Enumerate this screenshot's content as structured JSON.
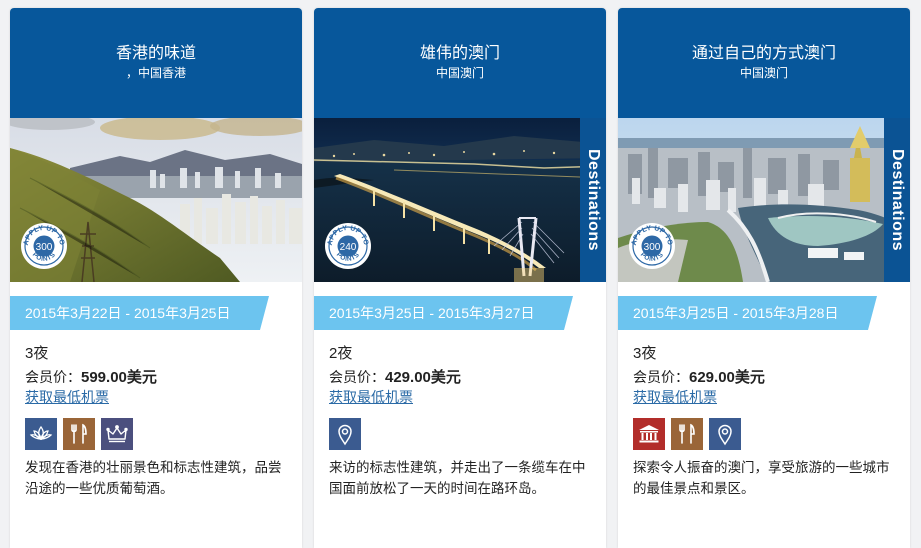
{
  "cards": [
    {
      "title": "香港的味道",
      "location": "，中国香港",
      "destinations_tag": "",
      "points_badge": {
        "top_text": "APPLY UP TO",
        "value": "300",
        "bottom_text": "POINTS"
      },
      "date_range": "2015年3月22日 - 2015年3月25日",
      "nights": "3夜",
      "price_label": "会员价：",
      "price_value": "599.00美元",
      "fare_link": "获取最低机票",
      "icons": [
        "lotus-spa-icon",
        "dining-icon",
        "crown-icon"
      ],
      "description": "发现在香港的壮丽景色和标志性建筑，品尝沿途的一些优质葡萄酒。"
    },
    {
      "title": "雄伟的澳门",
      "location": "中国澳门",
      "destinations_tag": "Destinations",
      "points_badge": {
        "top_text": "APPLY UP TO",
        "value": "240",
        "bottom_text": "POINTS"
      },
      "date_range": "2015年3月25日 - 2015年3月27日",
      "nights": "2夜",
      "price_label": "会员价：",
      "price_value": "429.00美元",
      "fare_link": "获取最低机票",
      "icons": [
        "map-pin-icon"
      ],
      "description": "来访的标志性建筑，并走出了一条缆车在中国面前放松了一天的时间在路环岛。"
    },
    {
      "title": "通过自己的方式澳门",
      "location": "中国澳门",
      "destinations_tag": "Destinations",
      "points_badge": {
        "top_text": "APPLY UP TO",
        "value": "300",
        "bottom_text": "POINTS"
      },
      "date_range": "2015年3月25日 - 2015年3月28日",
      "nights": "3夜",
      "price_label": "会员价：",
      "price_value": "629.00美元",
      "fare_link": "获取最低机票",
      "icons": [
        "museum-icon",
        "dining-icon",
        "map-pin-icon"
      ],
      "description": "探索令人振奋的澳门，享受旅游的一些城市的最佳景点和景区。"
    }
  ],
  "colors": {
    "header_blue": "#07579b",
    "date_band_blue": "#6cc4ef",
    "link_blue": "#2a6aa6",
    "tag_blue": "#0b5394"
  }
}
